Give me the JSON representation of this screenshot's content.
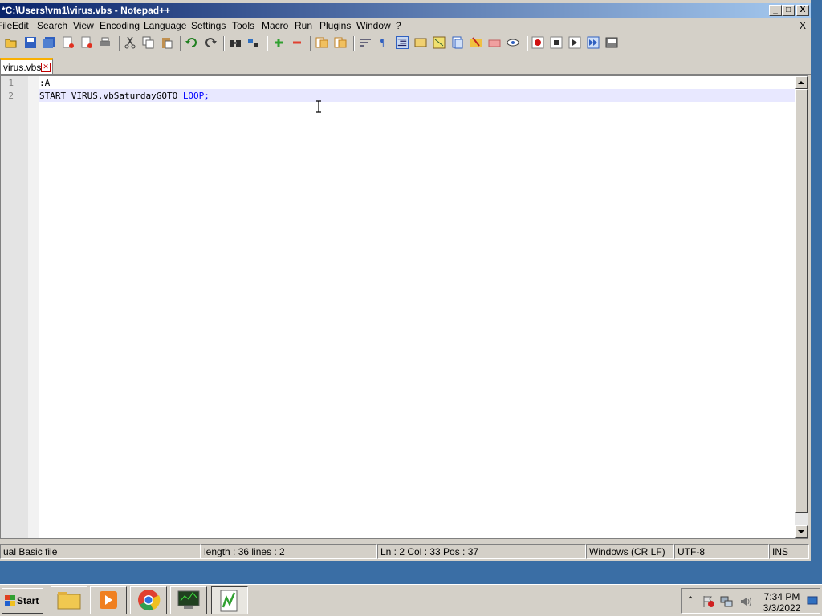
{
  "window": {
    "title": "*C:\\Users\\vm1\\virus.vbs - Notepad++",
    "minimize": "_",
    "maximize": "□",
    "close": "X"
  },
  "menu": {
    "items": [
      "File",
      "Edit",
      "Search",
      "View",
      "Encoding",
      "Language",
      "Settings",
      "Tools",
      "Macro",
      "Run",
      "Plugins",
      "Window",
      "?"
    ],
    "close": "X"
  },
  "tab": {
    "label": "virus.vbs",
    "close": "✕"
  },
  "editor": {
    "line_numbers": [
      "1",
      "2"
    ],
    "line1": ":A",
    "line2_prefix": "START VIRUS.vbSaturdayGOTO ",
    "line2_keyword": "LOOP;"
  },
  "status": {
    "filetype": "ual Basic file",
    "length": "length : 36    lines : 2",
    "position": "Ln : 2    Col : 33    Pos : 37",
    "eol": "Windows (CR LF)",
    "encoding": "UTF-8",
    "mode": "INS"
  },
  "taskbar": {
    "start": "Start",
    "clock_time": "7:34 PM",
    "clock_date": "3/3/2022"
  },
  "colors": {
    "titlebar": "#0a246a",
    "keyword": "#0000ff",
    "tab_accent": "#fab000",
    "current_line": "#e8e8ff"
  }
}
